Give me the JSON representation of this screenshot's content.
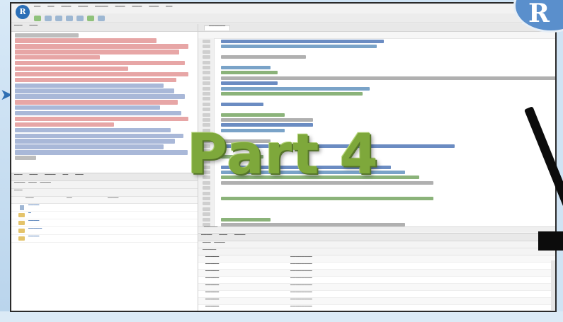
{
  "overlay": {
    "title": "Part 4",
    "badge_letter": "R"
  },
  "app": {
    "logo_letter": "R"
  },
  "colors": {
    "title_green": "#7ea83b",
    "badge_blue": "#5a8fcc",
    "frame": "#2a2a2a"
  }
}
